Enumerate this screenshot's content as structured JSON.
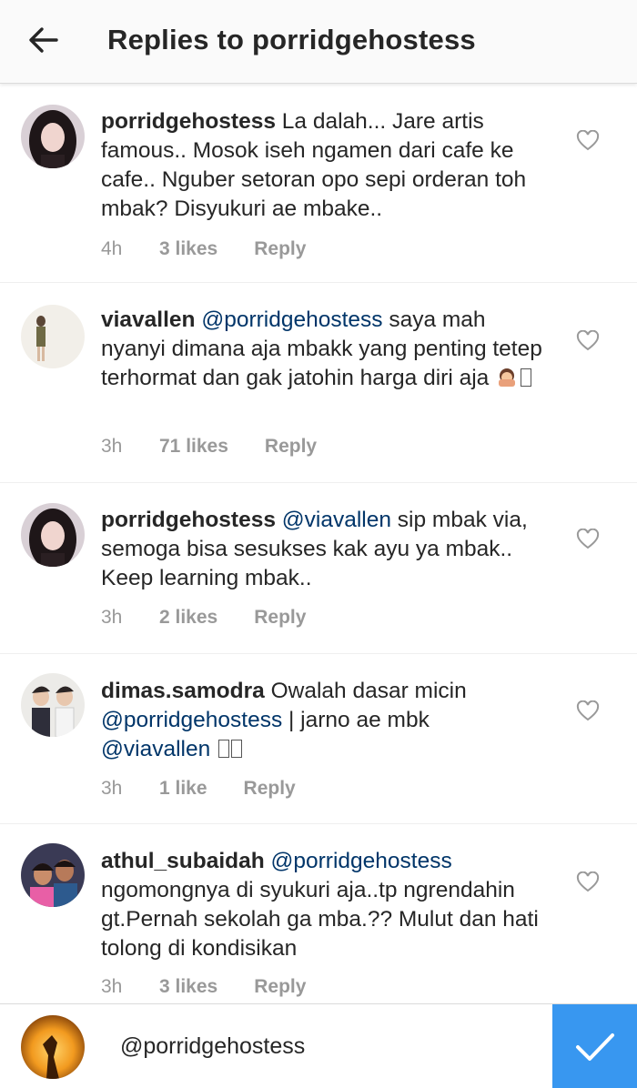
{
  "header": {
    "title": "Replies to porridgehostess",
    "back_icon": "arrow-left-icon"
  },
  "comments": [
    {
      "username": "porridgehostess",
      "mention": "",
      "text": "La dalah... Jare artis famous.. Mosok iseh ngamen dari cafe ke cafe.. Nguber setoran opo sepi orderan toh mbak? Disyukuri ae mbake..",
      "time": "4h",
      "likes": "3 likes",
      "reply": "Reply"
    },
    {
      "username": "viavallen",
      "mention": "@porridgehostess",
      "text": "saya mah nyanyi dimana aja mbakk yang penting tetep terhormat dan gak jatohin harga diri aja",
      "time": "3h",
      "likes": "71 likes",
      "reply": "Reply"
    },
    {
      "username": "porridgehostess",
      "mention": "@viavallen",
      "text": "sip mbak via, semoga bisa sesukses kak ayu ya mbak.. Keep learning mbak..",
      "time": "3h",
      "likes": "2 likes",
      "reply": "Reply"
    },
    {
      "username": "dimas.samodra",
      "text_a": "Owalah dasar micin",
      "mention_a": "@porridgehostess",
      "text_b": "|  jarno ae mbk",
      "mention_b": "@viavallen",
      "time": "3h",
      "likes": "1 like",
      "reply": "Reply"
    },
    {
      "username": "athul_subaidah",
      "mention": "@porridgehostess",
      "text": "ngomongnya di syukuri aja..tp ngrendahin gt.Pernah sekolah ga mba.?? Mulut dan hati tolong di kondisikan",
      "time": "3h",
      "likes": "3 likes",
      "reply": "Reply"
    }
  ],
  "composer": {
    "value": "@porridgehostess",
    "send_icon": "checkmark-icon"
  },
  "colors": {
    "accent": "#3897f0",
    "mention": "#003569",
    "meta": "#999999",
    "text": "#262626"
  }
}
